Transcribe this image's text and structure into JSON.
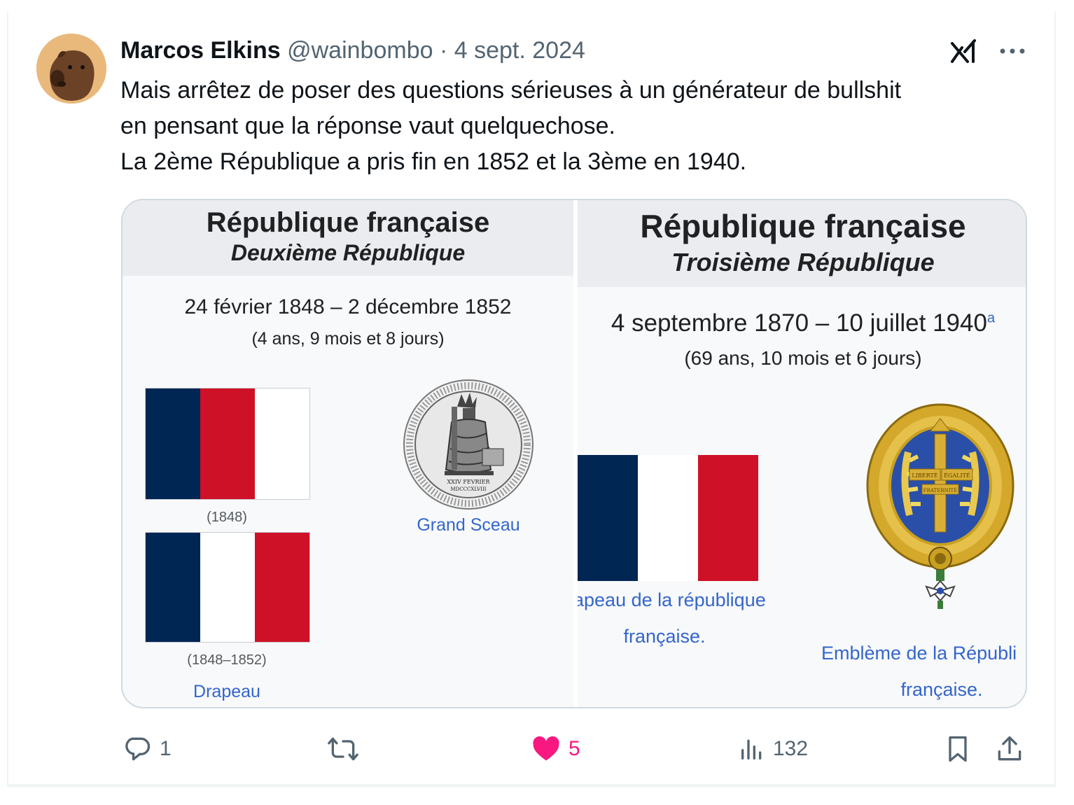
{
  "tweet": {
    "author_name": "Marcos Elkins",
    "handle": "@wainbombo",
    "separator": "·",
    "date": "4 sept. 2024",
    "text_lines": [
      "Mais arrêtez de poser des questions sérieuses à un générateur de bullshit",
      "en pensant que la réponse vaut quelquechose.",
      "La 2ème République a pris fin en 1852 et la 3ème en 1940."
    ],
    "icons": {
      "grok": "grok-icon",
      "more": "more-icon",
      "avatar": "capybara-avatar"
    }
  },
  "media": {
    "left": {
      "title": "République française",
      "subtitle": "Deuxième République",
      "dates": "24 février 1848 – 2 décembre 1852",
      "duration": "(4 ans, 9 mois et 8 jours)",
      "flag1_caption": "(1848)",
      "flag2_caption": "(1848–1852)",
      "flag_link": "Drapeau",
      "seal_link": "Grand Sceau",
      "seal_text_bottom": "XXIV FEVRIER",
      "seal_text_bottom2": "MDCCCXLVIII"
    },
    "right": {
      "title": "République française",
      "subtitle": "Troisième République",
      "dates": "4 septembre 1870 – 10 juillet 1940",
      "dates_sup": "a",
      "duration": "(69 ans, 10 mois et 6 jours)",
      "flag_link_line1": "apeau de la république",
      "flag_link_line2": "française.",
      "emblem_link_line1": "Emblème de la Républi",
      "emblem_link_line2": "française.",
      "emblem_words": [
        "LIBERTÉ",
        "ÉGALITÉ",
        "FRATERNITÉ"
      ]
    }
  },
  "actions": {
    "replies": "1",
    "reposts": "",
    "likes": "5",
    "views": "132",
    "colors": {
      "muted": "#536471",
      "like": "#f91880"
    }
  }
}
